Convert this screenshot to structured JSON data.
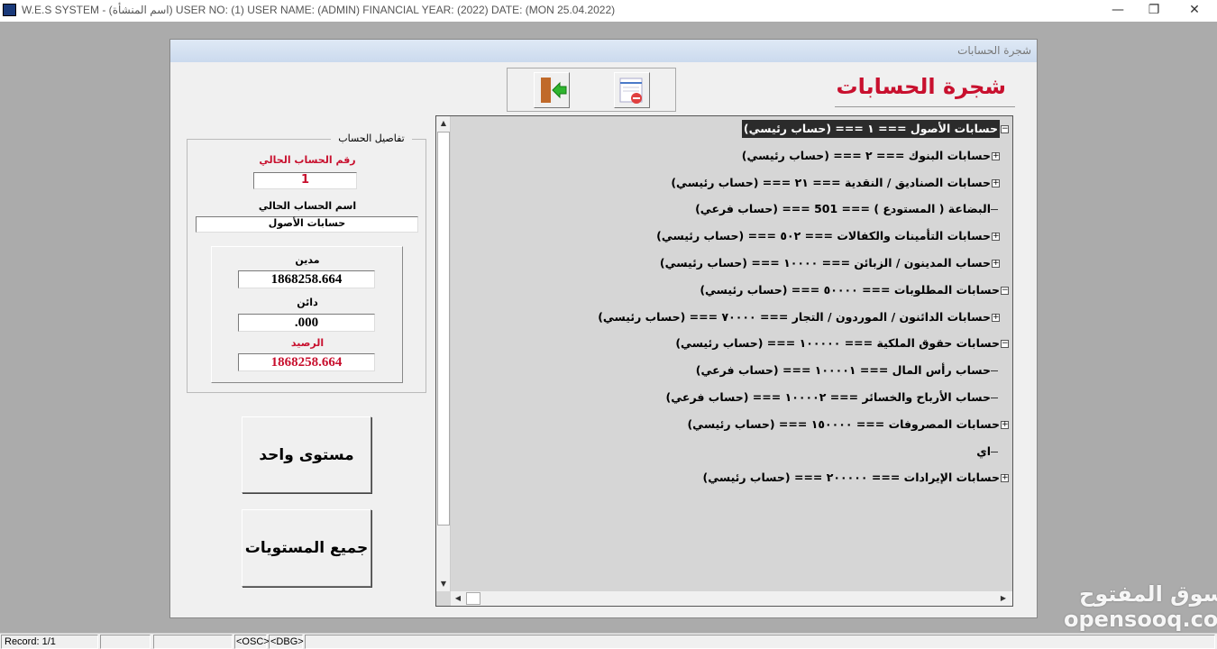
{
  "window": {
    "title": "W.E.S SYSTEM -  (اسم المنشأة)  USER NO: (1) USER NAME: (ADMIN) FINANCIAL YEAR: (2022)  DATE: (MON 25.04.2022)",
    "minimize": "—",
    "restore": "❐",
    "close": "✕"
  },
  "form": {
    "caption": "شجرة الحسابات",
    "heading": "شجرة الحسابات"
  },
  "toolbar": {
    "exit_icon": "exit-door-icon",
    "delete_icon": "delete-list-icon"
  },
  "details": {
    "legend": "تفاصيل الحساب",
    "account_no_label": "رقم الحساب الحالي",
    "account_no": "1",
    "account_name_label": "اسم الحساب الحالي",
    "account_name": "حسابات الأصول",
    "debit_label": "مدين",
    "debit": "1868258.664",
    "credit_label": "دائن",
    "credit": ".000",
    "balance_label": "الرصيد",
    "balance": "1868258.664"
  },
  "buttons": {
    "one_level": "مستوى واحد",
    "all_levels": "جميع المستويات"
  },
  "tree": [
    {
      "text": "حسابات الأصول ===  ١ === (حساب رئيسي)",
      "level": 0,
      "state": "expanded",
      "selected": true
    },
    {
      "text": "حسابات البنوك ===  ٢ === (حساب رئيسي)",
      "level": 1,
      "state": "collapsed"
    },
    {
      "text": "حسابات الصناديق / النقدية ===  ٢١ === (حساب رئيسي)",
      "level": 1,
      "state": "collapsed"
    },
    {
      "text": "البضاعة ( المستودع ) ===  501 === (حساب فرعي)",
      "level": 1,
      "state": "leaf"
    },
    {
      "text": "حسابات التأمينات والكفالات ===  ٥٠٢ === (حساب رئيسي)",
      "level": 1,
      "state": "collapsed"
    },
    {
      "text": "حساب المدينون / الزبائن ===  ١٠٠٠٠ === (حساب رئيسي)",
      "level": 1,
      "state": "collapsed"
    },
    {
      "text": "حسابات المطلوبات ===  ٥٠٠٠٠ === (حساب رئيسي)",
      "level": 0,
      "state": "expanded"
    },
    {
      "text": "حسابات الدائنون / الموردون / التجار ===  ٧٠٠٠٠ === (حساب رئيسي)",
      "level": 1,
      "state": "collapsed"
    },
    {
      "text": "حسابات حقوق الملكية ===  ١٠٠٠٠٠ === (حساب رئيسي)",
      "level": 0,
      "state": "expanded"
    },
    {
      "text": "حساب رأس المال ===  ١٠٠٠٠١ === (حساب فرعي)",
      "level": 1,
      "state": "leaf"
    },
    {
      "text": "حساب الأرباح والخسائر ===  ١٠٠٠٠٢ === (حساب فرعي)",
      "level": 1,
      "state": "leaf"
    },
    {
      "text": "حسابات المصروفات ===  ١٥٠٠٠٠ === (حساب رئيسي)",
      "level": 0,
      "state": "collapsed"
    },
    {
      "text": "اي",
      "level": 1,
      "state": "leaf"
    },
    {
      "text": "حسابات الإيرادات ===  ٢٠٠٠٠٠ === (حساب رئيسي)",
      "level": 0,
      "state": "collapsed"
    }
  ],
  "status": {
    "record": "Record: 1/1",
    "osc": "<OSC>",
    "dbg": "<DBG>"
  },
  "watermark": "السوق المفتوح opensooq.com",
  "colors": {
    "accent_red": "#c8102e",
    "selection": "#2b2b2b"
  }
}
